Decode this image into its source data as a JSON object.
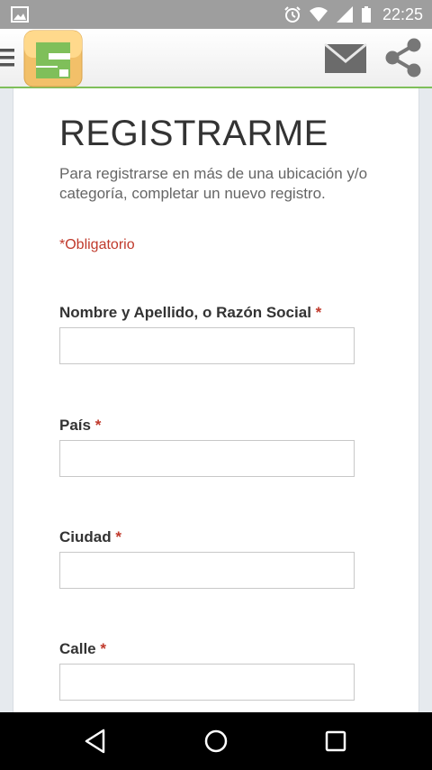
{
  "status_bar": {
    "time": "22:25",
    "icons": [
      "image-notification-icon",
      "alarm-icon",
      "wifi-icon",
      "signal-icon",
      "battery-icon"
    ]
  },
  "app_bar": {
    "icons": [
      "menu-icon",
      "app-logo",
      "mail-icon",
      "share-icon"
    ],
    "accent": "#7fbf5a"
  },
  "form": {
    "title": "REGISTRARME",
    "subtitle": "Para registrarse en más de una ubicación y/o categoría, completar un nuevo registro.",
    "required_note": "*Obligatorio",
    "fields": [
      {
        "label": "Nombre y Apellido, o Razón Social",
        "star": "*",
        "value": ""
      },
      {
        "label": "País",
        "star": "*",
        "value": ""
      },
      {
        "label": "Ciudad",
        "star": "*",
        "value": ""
      },
      {
        "label": "Calle",
        "star": "*",
        "value": ""
      }
    ],
    "required_color": "#c0392b"
  },
  "nav_bar": {
    "icons": [
      "back-icon",
      "home-icon",
      "recents-icon"
    ]
  }
}
